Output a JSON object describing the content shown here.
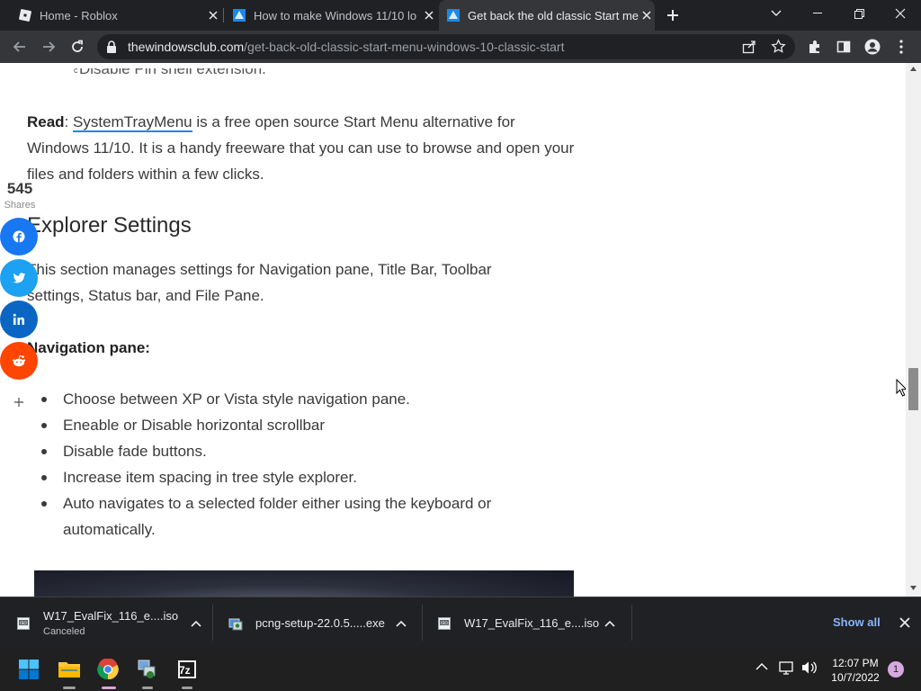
{
  "browser": {
    "tabs": [
      {
        "title": "Home - Roblox",
        "favicon": "roblox-icon"
      },
      {
        "title": "How to make Windows 11/10 lo",
        "favicon": "windowsclub-icon"
      },
      {
        "title": "Get back the old classic Start me",
        "favicon": "windowsclub-icon",
        "active": true
      }
    ],
    "url_domain": "thewindowsclub.com",
    "url_path": "/get-back-old-classic-start-menu-windows-10-classic-start"
  },
  "article": {
    "partial_item": "Disable Pin shell extension.",
    "read_label": "Read",
    "read_link": "SystemTrayMenu",
    "read_text": " is a free open source Start Menu alternative for Windows 11/10. It is a handy freeware that you can use to browse and open your files and folders within a few clicks.",
    "heading": "Explorer Settings",
    "intro": "This section manages settings for Navigation pane,  Title Bar, Toolbar settings, Status bar, and File Pane.",
    "subheading": "Navigation pane:",
    "bullets": [
      "Choose between XP or Vista style navigation pane.",
      "Eneable or Disable horizontal scrollbar",
      "Disable fade buttons.",
      "Increase item spacing in tree style explorer.",
      "Auto navigates to a selected folder either using the keyboard or automatically."
    ]
  },
  "share": {
    "count": "545",
    "label": "Shares",
    "buttons": [
      "facebook",
      "twitter",
      "linkedin",
      "reddit",
      "more"
    ],
    "colors": {
      "facebook": "#1877f2",
      "twitter": "#1da1f2",
      "linkedin": "#0a66c2",
      "reddit": "#ff4500"
    }
  },
  "downloads": {
    "items": [
      {
        "name": "W17_EvalFix_116_e....iso",
        "status": "Canceled"
      },
      {
        "name": "pcng-setup-22.0.5.....exe",
        "status": ""
      },
      {
        "name": "W17_EvalFix_116_e....iso",
        "status": ""
      }
    ],
    "show_all": "Show all"
  },
  "taskbar": {
    "time": "12:07 PM",
    "date": "10/7/2022",
    "notification_count": "1",
    "pinned": [
      "start-icon",
      "file-explorer-icon",
      "chrome-icon",
      "network-tool-icon",
      "7zip-icon"
    ],
    "sevenzip_label": "7z"
  },
  "colors": {
    "link": "#1e88e5",
    "accent": "#8ab4f8"
  }
}
